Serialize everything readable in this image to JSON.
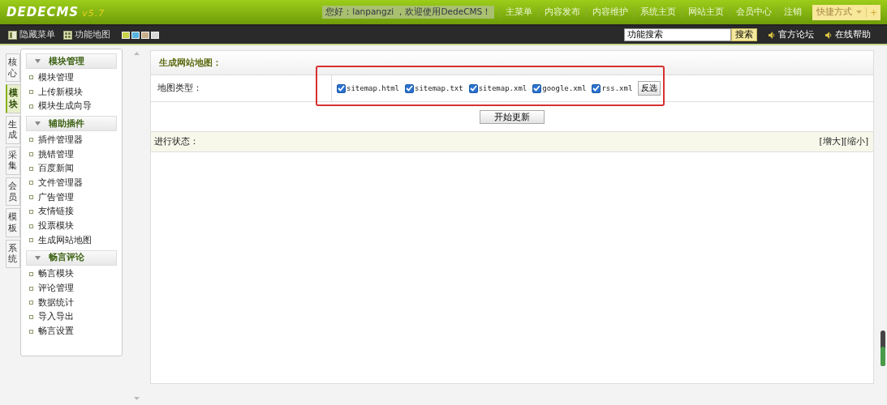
{
  "header": {
    "logo": "DEDECMS",
    "version": "v5.7",
    "greeting": "您好：lanpangzi ，欢迎使用DedeCMS！",
    "nav": [
      "主菜单",
      "内容发布",
      "内容维护",
      "系统主页",
      "网站主页",
      "会员中心",
      "注销"
    ],
    "shortcut": "快捷方式",
    "add": "+"
  },
  "toolbar": {
    "items": [
      {
        "label": "隐藏菜单",
        "kind": "hide"
      },
      {
        "label": "功能地图",
        "kind": "map"
      }
    ],
    "skins": [
      {
        "color": "#c8d448"
      },
      {
        "color": "#58b4e0"
      },
      {
        "color": "#c8ae8c"
      },
      {
        "color": "#d8d8d8"
      }
    ],
    "search": {
      "value": "功能搜索"
    },
    "search_button": "搜索",
    "links": [
      "官方论坛",
      "在线帮助"
    ]
  },
  "side_tabs": [
    {
      "label": "核心",
      "selected": false
    },
    {
      "label": "模块",
      "selected": true
    },
    {
      "label": "生成",
      "selected": false
    },
    {
      "label": "采集",
      "selected": false
    },
    {
      "label": "会员",
      "selected": false
    },
    {
      "label": "模板",
      "selected": false
    },
    {
      "label": "系统",
      "selected": false
    }
  ],
  "menu": [
    {
      "title": "模块管理",
      "expanded": true,
      "items": [
        "模块管理",
        "上传新模块",
        "模块生成向导"
      ]
    },
    {
      "title": "辅助插件",
      "expanded": true,
      "items": [
        "插件管理器",
        "挑错管理",
        "百度新闻",
        "文件管理器",
        "广告管理",
        "友情链接",
        "投票模块",
        "生成网站地图"
      ]
    },
    {
      "title": "畅言评论",
      "expanded": true,
      "items": [
        "畅言模块",
        "评论管理",
        "数据统计",
        "导入导出",
        "畅言设置"
      ]
    }
  ],
  "main": {
    "title": "生成网站地图：",
    "map_type_label": "地图类型：",
    "options": [
      {
        "label": "sitemap.html",
        "checked": true
      },
      {
        "label": "sitemap.txt",
        "checked": true
      },
      {
        "label": "sitemap.xml",
        "checked": true
      },
      {
        "label": "google.xml",
        "checked": true
      },
      {
        "label": "rss.xml",
        "checked": true
      }
    ],
    "invert_button": "反选",
    "start_button": "开始更新",
    "status_label": "进行状态：",
    "size_links": [
      "[增大]",
      "[缩小]"
    ]
  }
}
